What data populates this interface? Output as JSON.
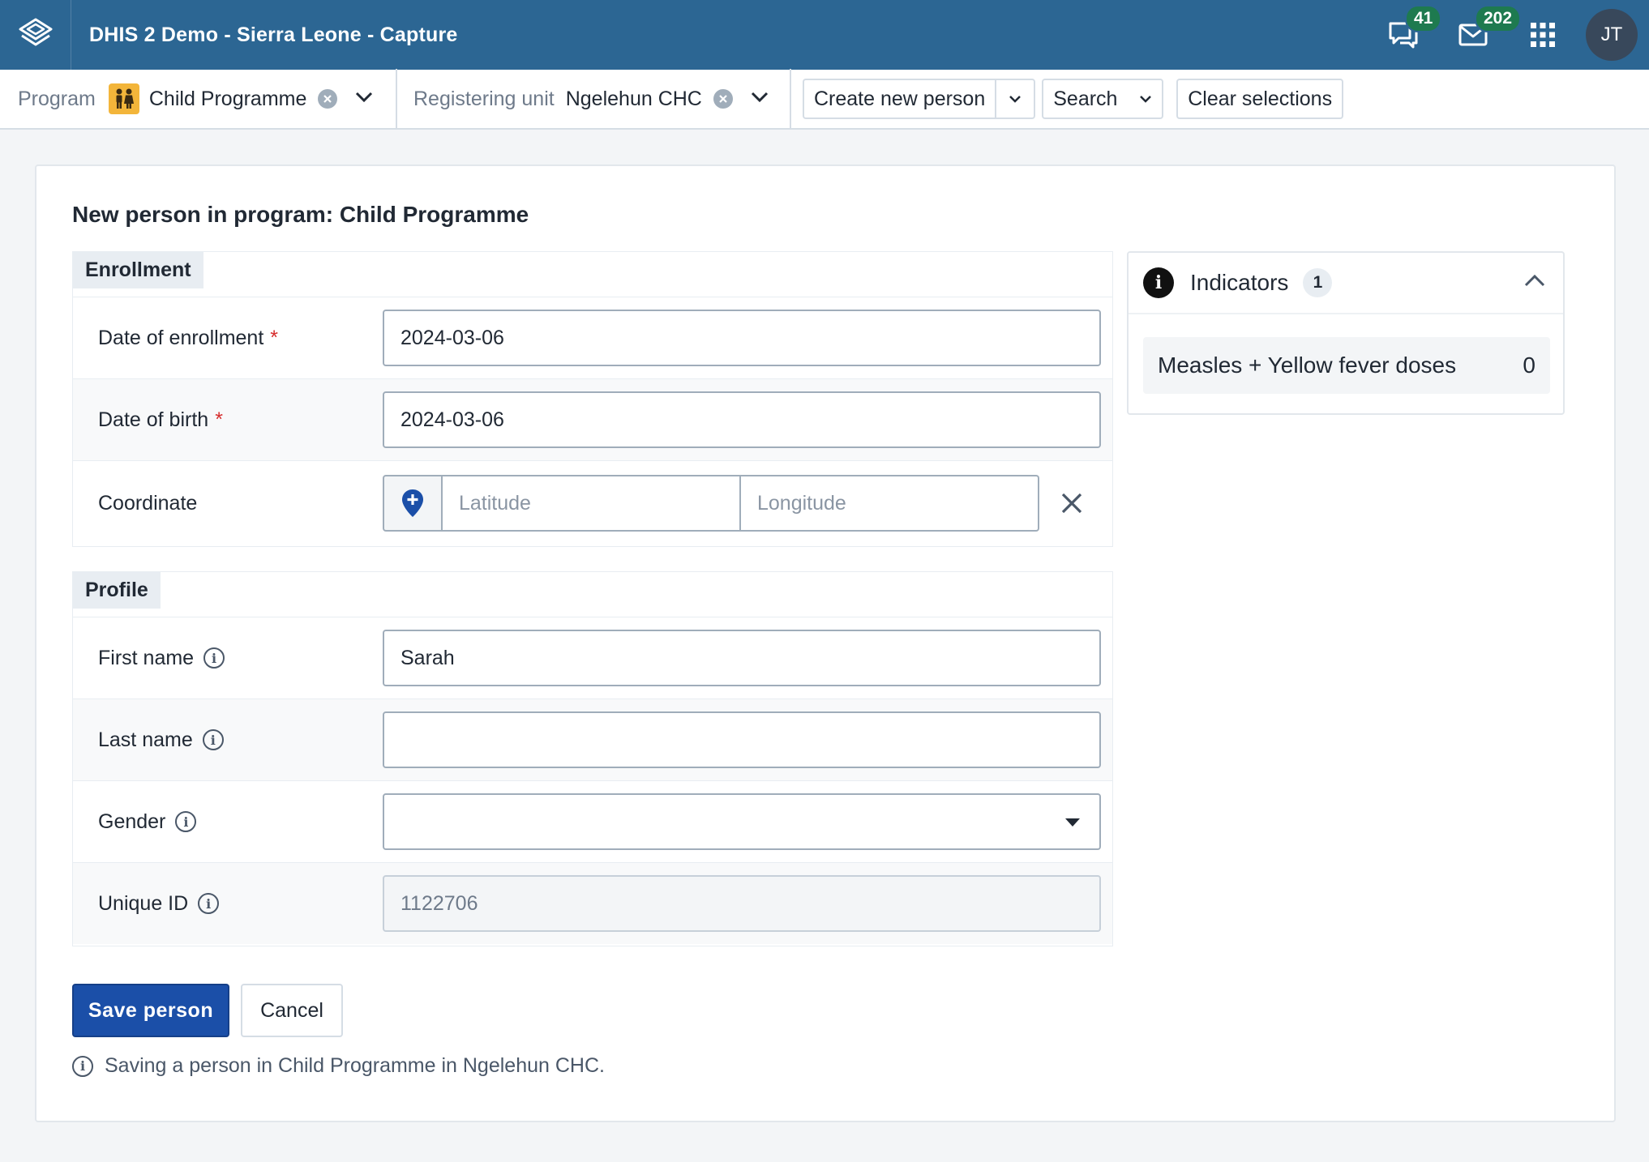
{
  "header": {
    "app_title": "DHIS 2 Demo - Sierra Leone - Capture",
    "interpretations_count": "41",
    "messages_count": "202",
    "user_initials": "JT"
  },
  "selector": {
    "program_label": "Program",
    "program_value": "Child Programme",
    "org_unit_label": "Registering unit",
    "org_unit_value": "Ngelehun CHC",
    "create_new_label": "Create new person",
    "search_label": "Search",
    "clear_label": "Clear selections"
  },
  "form": {
    "title": "New person in program: Child Programme",
    "enrollment": {
      "heading": "Enrollment",
      "enrollment_date_label": "Date of enrollment",
      "enrollment_date_value": "2024-03-06",
      "birth_date_label": "Date of birth",
      "birth_date_value": "2024-03-06",
      "coordinate_label": "Coordinate",
      "latitude_placeholder": "Latitude",
      "longitude_placeholder": "Longitude",
      "required_mark": "*"
    },
    "profile": {
      "heading": "Profile",
      "first_name_label": "First name",
      "first_name_value": "Sarah",
      "last_name_label": "Last name",
      "last_name_value": "",
      "gender_label": "Gender",
      "gender_value": "",
      "unique_id_label": "Unique ID",
      "unique_id_value": "1122706"
    },
    "save_label": "Save person",
    "cancel_label": "Cancel",
    "save_note": "Saving a person in Child Programme in Ngelehun CHC."
  },
  "indicators": {
    "title": "Indicators",
    "count": "1",
    "items": [
      {
        "name": "Measles + Yellow fever doses",
        "value": "0"
      }
    ]
  },
  "colors": {
    "header_bg": "#2c6693",
    "primary_button": "#1b4fa8",
    "badge": "#1e7a4f",
    "required": "#d62d2d",
    "program_icon": "#f3b53a"
  },
  "icons": {
    "logo": "dhis2-logo-icon",
    "interpretations": "chat-icon",
    "messages": "mail-icon",
    "apps": "apps-grid-icon",
    "program": "children-icon",
    "coordinate": "map-pin-icon",
    "clear": "close-icon",
    "info": "info-icon"
  }
}
